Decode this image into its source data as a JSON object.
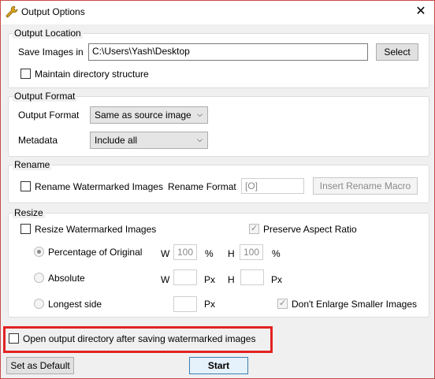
{
  "window": {
    "title": "Output Options",
    "close_glyph": "✕",
    "icon": "wrench-icon"
  },
  "output_location": {
    "legend": "Output Location",
    "save_label": "Save Images in",
    "path": "C:\\Users\\Yash\\Desktop",
    "select_button": "Select",
    "maintain_label": "Maintain directory structure",
    "maintain_checked": false
  },
  "output_format": {
    "legend": "Output Format",
    "format_label": "Output Format",
    "format_value": "Same as source image",
    "metadata_label": "Metadata",
    "metadata_value": "Include all"
  },
  "rename": {
    "legend": "Rename",
    "rename_label": "Rename Watermarked Images",
    "rename_checked": false,
    "format_label": "Rename Format",
    "format_value": "[O]",
    "macro_button": "Insert Rename Macro"
  },
  "resize": {
    "legend": "Resize",
    "resize_label": "Resize Watermarked Images",
    "resize_checked": false,
    "aspect_label": "Preserve Aspect Ratio",
    "aspect_checked": true,
    "percentage": {
      "label": "Percentage of Original",
      "w_label": "W",
      "w_value": "100",
      "w_unit": "%",
      "h_label": "H",
      "h_value": "100",
      "h_unit": "%",
      "selected": true
    },
    "absolute": {
      "label": "Absolute",
      "w_label": "W",
      "w_value": "",
      "w_unit": "Px",
      "h_label": "H",
      "h_value": "",
      "h_unit": "Px",
      "selected": false
    },
    "longest": {
      "label": "Longest side",
      "value": "",
      "unit": "Px",
      "selected": false
    },
    "no_enlarge_label": "Don't Enlarge Smaller Images",
    "no_enlarge_checked": true
  },
  "open_dir": {
    "label": "Open output directory after saving watermarked images",
    "checked": false,
    "highlight_color": "#e32222"
  },
  "footer": {
    "default_button": "Set as Default",
    "start_button": "Start"
  },
  "check_glyph": "✓"
}
